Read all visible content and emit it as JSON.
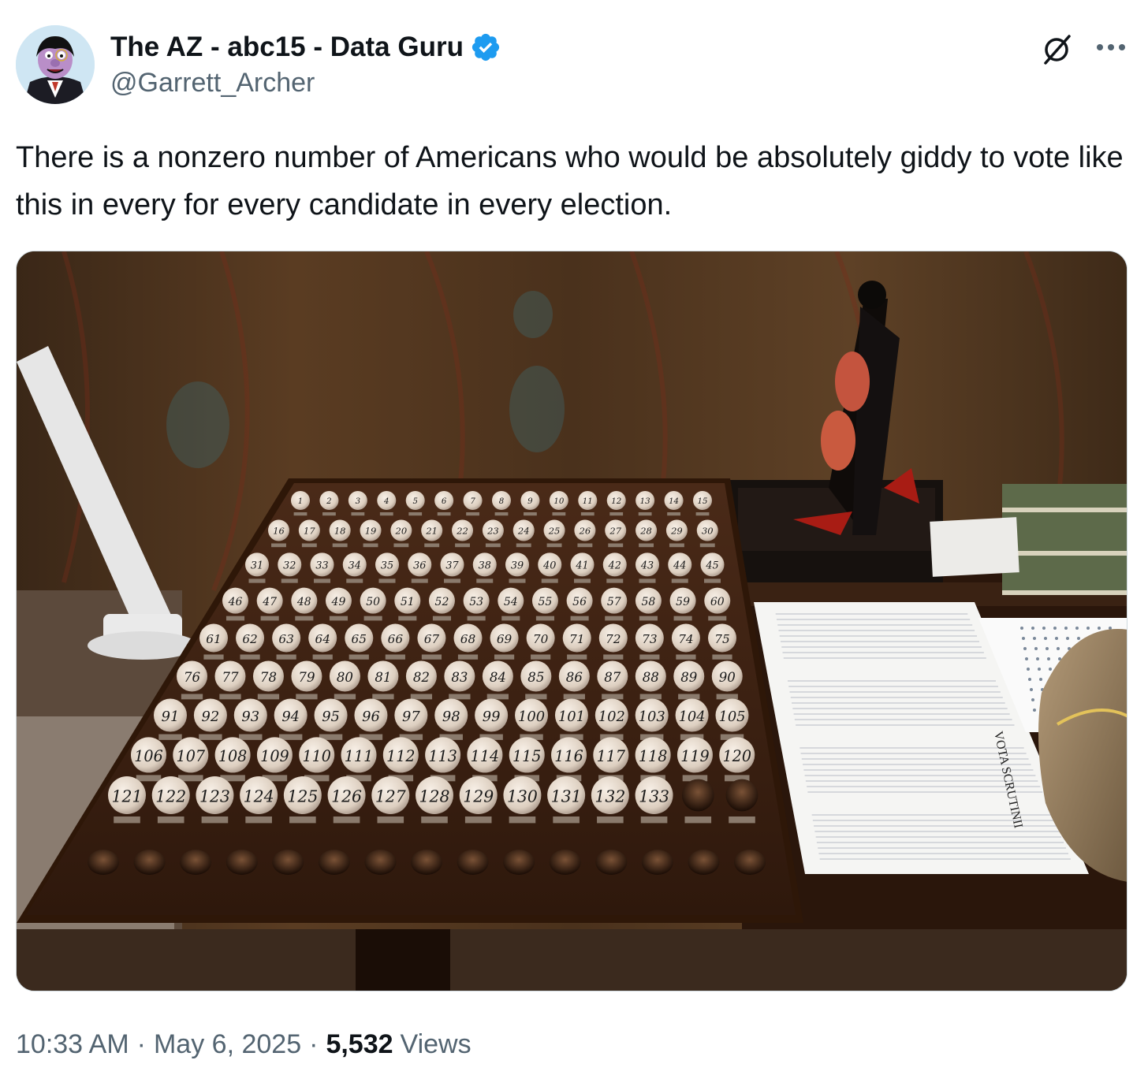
{
  "author": {
    "display_name": "The AZ - abc15 - Data Guru",
    "handle": "@Garrett_Archer",
    "verified": true,
    "avatar_icon": "count-von-count-avatar",
    "verified_color": "#1d9bf0"
  },
  "actions": {
    "grok_icon": "grok-icon",
    "more_icon": "more-dots-icon"
  },
  "tweet": {
    "text": "There is a nonzero number of Americans who would be absolutely giddy to vote like this in every for every candidate in every election."
  },
  "media": {
    "type": "photo",
    "ballot_numbers": [
      "1",
      "2",
      "3",
      "4",
      "5",
      "6",
      "7",
      "8",
      "9",
      "10",
      "11",
      "12",
      "13",
      "14",
      "15",
      "16",
      "17",
      "18",
      "19",
      "20",
      "21",
      "22",
      "23",
      "24",
      "25",
      "26",
      "27",
      "28",
      "29",
      "30",
      "31",
      "32",
      "33",
      "34",
      "35",
      "36",
      "37",
      "38",
      "39",
      "40",
      "41",
      "42",
      "43",
      "44",
      "45",
      "46",
      "47",
      "48",
      "49",
      "50",
      "51",
      "52",
      "53",
      "54",
      "55",
      "56",
      "57",
      "58",
      "59",
      "60",
      "61",
      "62",
      "63",
      "64",
      "65",
      "66",
      "67",
      "68",
      "69",
      "70",
      "71",
      "72",
      "73",
      "74",
      "75",
      "76",
      "77",
      "78",
      "79",
      "80",
      "81",
      "82",
      "83",
      "84",
      "85",
      "86",
      "87",
      "88",
      "89",
      "90",
      "91",
      "92",
      "93",
      "94",
      "95",
      "96",
      "97",
      "98",
      "99",
      "100",
      "101",
      "102",
      "103",
      "104",
      "105",
      "106",
      "107",
      "108",
      "109",
      "110",
      "111",
      "112",
      "113",
      "114",
      "115",
      "116",
      "117",
      "118",
      "119",
      "120",
      "121",
      "122",
      "123",
      "124",
      "125",
      "126",
      "127",
      "128",
      "129",
      "130",
      "131",
      "132",
      "133"
    ],
    "sheet_heading": "VOTA SCRUTINII"
  },
  "meta": {
    "time": "10:33 AM",
    "separator": "·",
    "date": "May 6, 2025",
    "views_count": "5,532",
    "views_label": "Views"
  },
  "colors": {
    "text_primary": "#0f1419",
    "text_secondary": "#536471",
    "accent": "#1d9bf0"
  }
}
